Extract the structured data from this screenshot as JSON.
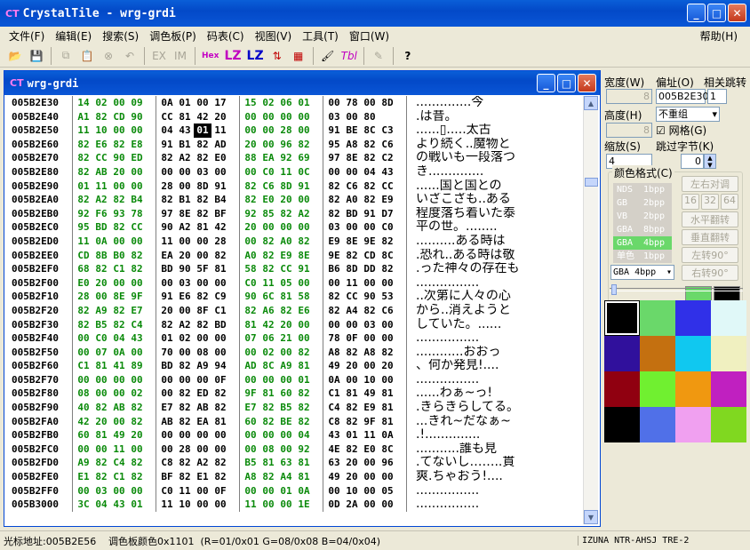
{
  "window": {
    "title": "CrystalTile - wrg-grdi",
    "logo": "CT"
  },
  "menu": [
    "文件(F)",
    "编辑(E)",
    "搜索(S)",
    "调色板(P)",
    "码表(C)",
    "视图(V)",
    "工具(T)",
    "窗口(W)"
  ],
  "menu_help": "帮助(H)",
  "toolbar": {
    "ex": "EX",
    "im": "IM",
    "hex": "Hex",
    "lz1": "LZ",
    "lz2": "LZ",
    "tbl": "Tbl"
  },
  "child": {
    "title": "wrg-grdi"
  },
  "rows": [
    {
      "addr": "005B2E30",
      "b": [
        "14",
        "02",
        "00",
        "09",
        "0A",
        "01",
        "00",
        "17",
        "15",
        "02",
        "06",
        "01",
        "00",
        "78",
        "00",
        "8D"
      ],
      "t": "..............今"
    },
    {
      "addr": "005B2E40",
      "b": [
        "A1",
        "82",
        "CD",
        "90",
        "CC",
        "81",
        "42",
        "20",
        "00",
        "00",
        "00",
        "00",
        "03",
        "00",
        "80"
      ],
      "t": ".は昔。"
    },
    {
      "addr": "005B2E50",
      "b": [
        "11",
        "10",
        "00",
        "00",
        "04",
        "43",
        "01",
        "11",
        "00",
        "00",
        "28",
        "00",
        "91",
        "BE",
        "8C",
        "C3"
      ],
      "t": "......▯.....太古"
    },
    {
      "addr": "005B2E60",
      "b": [
        "82",
        "E6",
        "82",
        "E8",
        "91",
        "B1",
        "82",
        "AD",
        "20",
        "00",
        "96",
        "82",
        "95",
        "A8",
        "82",
        "C6"
      ],
      "t": "より続く..魔物と"
    },
    {
      "addr": "005B2E70",
      "b": [
        "82",
        "CC",
        "90",
        "ED",
        "82",
        "A2",
        "82",
        "E0",
        "88",
        "EA",
        "92",
        "69",
        "97",
        "8E",
        "82",
        "C2"
      ],
      "t": "の戦いも一段落つ"
    },
    {
      "addr": "005B2E80",
      "b": [
        "82",
        "AB",
        "20",
        "00",
        "00",
        "00",
        "03",
        "00",
        "00",
        "C0",
        "11",
        "0C",
        "00",
        "00",
        "04",
        "43"
      ],
      "t": "き.............."
    },
    {
      "addr": "005B2E90",
      "b": [
        "01",
        "11",
        "00",
        "00",
        "28",
        "00",
        "8D",
        "91",
        "82",
        "C6",
        "8D",
        "91",
        "82",
        "C6",
        "82",
        "CC"
      ],
      "t": "......国と国との"
    },
    {
      "addr": "005B2EA0",
      "b": [
        "82",
        "A2",
        "82",
        "B4",
        "82",
        "B1",
        "82",
        "B4",
        "82",
        "E0",
        "20",
        "00",
        "82",
        "A0",
        "82",
        "E9"
      ],
      "t": "いざこざも..ある"
    },
    {
      "addr": "005B2EB0",
      "b": [
        "92",
        "F6",
        "93",
        "78",
        "97",
        "8E",
        "82",
        "BF",
        "92",
        "85",
        "82",
        "A2",
        "82",
        "BD",
        "91",
        "D7"
      ],
      "t": "程度落ち着いた泰"
    },
    {
      "addr": "005B2EC0",
      "b": [
        "95",
        "BD",
        "82",
        "CC",
        "90",
        "A2",
        "81",
        "42",
        "20",
        "00",
        "00",
        "00",
        "03",
        "00",
        "00",
        "C0"
      ],
      "t": "平の世。........"
    },
    {
      "addr": "005B2ED0",
      "b": [
        "11",
        "0A",
        "00",
        "00",
        "11",
        "00",
        "00",
        "28",
        "00",
        "82",
        "A0",
        "82",
        "E9",
        "8E",
        "9E",
        "82"
      ],
      "t": "..........ある時は"
    },
    {
      "addr": "005B2EE0",
      "b": [
        "CD",
        "8B",
        "B0",
        "82",
        "EA",
        "20",
        "00",
        "82",
        "A0",
        "82",
        "E9",
        "8E",
        "9E",
        "82",
        "CD",
        "8C"
      ],
      "t": ".恐れ..ある時は敬"
    },
    {
      "addr": "005B2EF0",
      "b": [
        "68",
        "82",
        "C1",
        "82",
        "BD",
        "90",
        "5F",
        "81",
        "58",
        "82",
        "CC",
        "91",
        "B6",
        "8D",
        "DD",
        "82"
      ],
      "t": ".った神々の存在も"
    },
    {
      "addr": "005B2F00",
      "b": [
        "E0",
        "20",
        "00",
        "00",
        "00",
        "03",
        "00",
        "00",
        "C0",
        "11",
        "05",
        "00",
        "00",
        "11",
        "00",
        "00"
      ],
      "t": "................"
    },
    {
      "addr": "005B2F10",
      "b": [
        "28",
        "00",
        "8E",
        "9F",
        "91",
        "E6",
        "82",
        "C9",
        "90",
        "6C",
        "81",
        "58",
        "82",
        "CC",
        "90",
        "53"
      ],
      "t": "..次第に人々の心"
    },
    {
      "addr": "005B2F20",
      "b": [
        "82",
        "A9",
        "82",
        "E7",
        "20",
        "00",
        "8F",
        "C1",
        "82",
        "A6",
        "82",
        "E6",
        "82",
        "A4",
        "82",
        "C6"
      ],
      "t": "から..消えようと"
    },
    {
      "addr": "005B2F30",
      "b": [
        "82",
        "B5",
        "82",
        "C4",
        "82",
        "A2",
        "82",
        "BD",
        "81",
        "42",
        "20",
        "00",
        "00",
        "00",
        "03",
        "00"
      ],
      "t": "していた。......"
    },
    {
      "addr": "005B2F40",
      "b": [
        "00",
        "C0",
        "04",
        "43",
        "01",
        "02",
        "00",
        "00",
        "07",
        "06",
        "21",
        "00",
        "78",
        "0F",
        "00",
        "00"
      ],
      "t": "................"
    },
    {
      "addr": "005B2F50",
      "b": [
        "00",
        "07",
        "0A",
        "00",
        "70",
        "00",
        "08",
        "00",
        "00",
        "02",
        "00",
        "82",
        "A8",
        "82",
        "A8",
        "82"
      ],
      "t": "............おおっ"
    },
    {
      "addr": "005B2F60",
      "b": [
        "C1",
        "81",
        "41",
        "89",
        "BD",
        "82",
        "A9",
        "94",
        "AD",
        "8C",
        "A9",
        "81",
        "49",
        "20",
        "00",
        "20"
      ],
      "t": "、何か発見!...."
    },
    {
      "addr": "005B2F70",
      "b": [
        "00",
        "00",
        "00",
        "00",
        "00",
        "00",
        "00",
        "0F",
        "00",
        "00",
        "00",
        "01",
        "0A",
        "00",
        "10",
        "00"
      ],
      "t": "................"
    },
    {
      "addr": "005B2F80",
      "b": [
        "08",
        "00",
        "00",
        "02",
        "00",
        "82",
        "ED",
        "82",
        "9F",
        "81",
        "60",
        "82",
        "C1",
        "81",
        "49",
        "81"
      ],
      "t": "......わぁ~っ!"
    },
    {
      "addr": "005B2F90",
      "b": [
        "40",
        "82",
        "AB",
        "82",
        "E7",
        "82",
        "AB",
        "82",
        "E7",
        "82",
        "B5",
        "82",
        "C4",
        "82",
        "E9",
        "81"
      ],
      "t": ".きらきらしてる。"
    },
    {
      "addr": "005B2FA0",
      "b": [
        "42",
        "20",
        "00",
        "82",
        "AB",
        "82",
        "EA",
        "81",
        "60",
        "82",
        "BE",
        "82",
        "C8",
        "82",
        "9F",
        "81"
      ],
      "t": "...きれ~だなぁ~"
    },
    {
      "addr": "005B2FB0",
      "b": [
        "60",
        "81",
        "49",
        "20",
        "00",
        "00",
        "00",
        "00",
        "00",
        "00",
        "00",
        "04",
        "43",
        "01",
        "11",
        "0A"
      ],
      "t": ".!.............."
    },
    {
      "addr": "005B2FC0",
      "b": [
        "00",
        "00",
        "11",
        "00",
        "00",
        "28",
        "00",
        "00",
        "00",
        "08",
        "00",
        "92",
        "4E",
        "82",
        "E0",
        "8C"
      ],
      "t": "...........誰も見"
    },
    {
      "addr": "005B2FD0",
      "b": [
        "A9",
        "82",
        "C4",
        "82",
        "C8",
        "82",
        "A2",
        "82",
        "B5",
        "81",
        "63",
        "81",
        "63",
        "20",
        "00",
        "96"
      ],
      "t": ".てないし……..貫"
    },
    {
      "addr": "005B2FE0",
      "b": [
        "E1",
        "82",
        "C1",
        "82",
        "BF",
        "82",
        "E1",
        "82",
        "A8",
        "82",
        "A4",
        "81",
        "49",
        "20",
        "00",
        "00"
      ],
      "t": "爽.ちゃおう!...."
    },
    {
      "addr": "005B2FF0",
      "b": [
        "00",
        "03",
        "00",
        "00",
        "C0",
        "11",
        "00",
        "0F",
        "00",
        "00",
        "01",
        "0A",
        "00",
        "10",
        "00",
        "05"
      ],
      "t": "................"
    },
    {
      "addr": "005B3000",
      "b": [
        "3C",
        "04",
        "43",
        "01",
        "11",
        "10",
        "00",
        "00",
        "11",
        "00",
        "00",
        "1E",
        "0D",
        "2A",
        "00",
        "00"
      ],
      "t": "................"
    }
  ],
  "panel": {
    "width_label": "宽度(W)",
    "width_value": "8",
    "offset_label": "偏址(O)",
    "offset_value": "005B2E30",
    "jump_label": "相关跳转",
    "jump_value": "1",
    "height_label": "高度(H)",
    "height_value": "8",
    "overlap_value": "不重组",
    "grid_label": "网格(G)",
    "zoom_label": "缩放(S)",
    "zoom_value": "4",
    "skip_label": "跳过字节(K)",
    "skip_value": "0",
    "format_label": "颜色格式(C)",
    "formats": [
      {
        "name": "NDS",
        "bpp": "1bpp"
      },
      {
        "name": "GB",
        "bpp": "2bpp"
      },
      {
        "name": "VB",
        "bpp": "2bpp"
      },
      {
        "name": "GBA",
        "bpp": "8bpp"
      },
      {
        "name": "GBA",
        "bpp": "4bpp"
      },
      {
        "name": "单色",
        "bpp": "1bpp"
      }
    ],
    "format_select": "GBA  4bpp",
    "btn_lr": "左右对调",
    "sizes": [
      "16",
      "32",
      "64"
    ],
    "btn_hflip": "水平翻转",
    "btn_vflip": "垂直翻转",
    "btn_rotl": "左转90°",
    "btn_rotr": "右转90°"
  },
  "palette": [
    "#000000",
    "#6ad86a",
    "#3030e8",
    "#e0f8f8",
    "#30109c",
    "#c47010",
    "#10c8f0",
    "#f0f0c0",
    "#900010",
    "#70f030",
    "#f09810",
    "#c020c0",
    "#000000",
    "#5070e8",
    "#f0a0f0",
    "#80d820"
  ],
  "status": {
    "cursor": "光标地址:005B2E56",
    "palette": "调色板颜色0x1101  (R=01/0x01 G=08/0x08 B=04/0x04)",
    "rom": "IZUNA NTR-AHSJ  TRE-2"
  }
}
